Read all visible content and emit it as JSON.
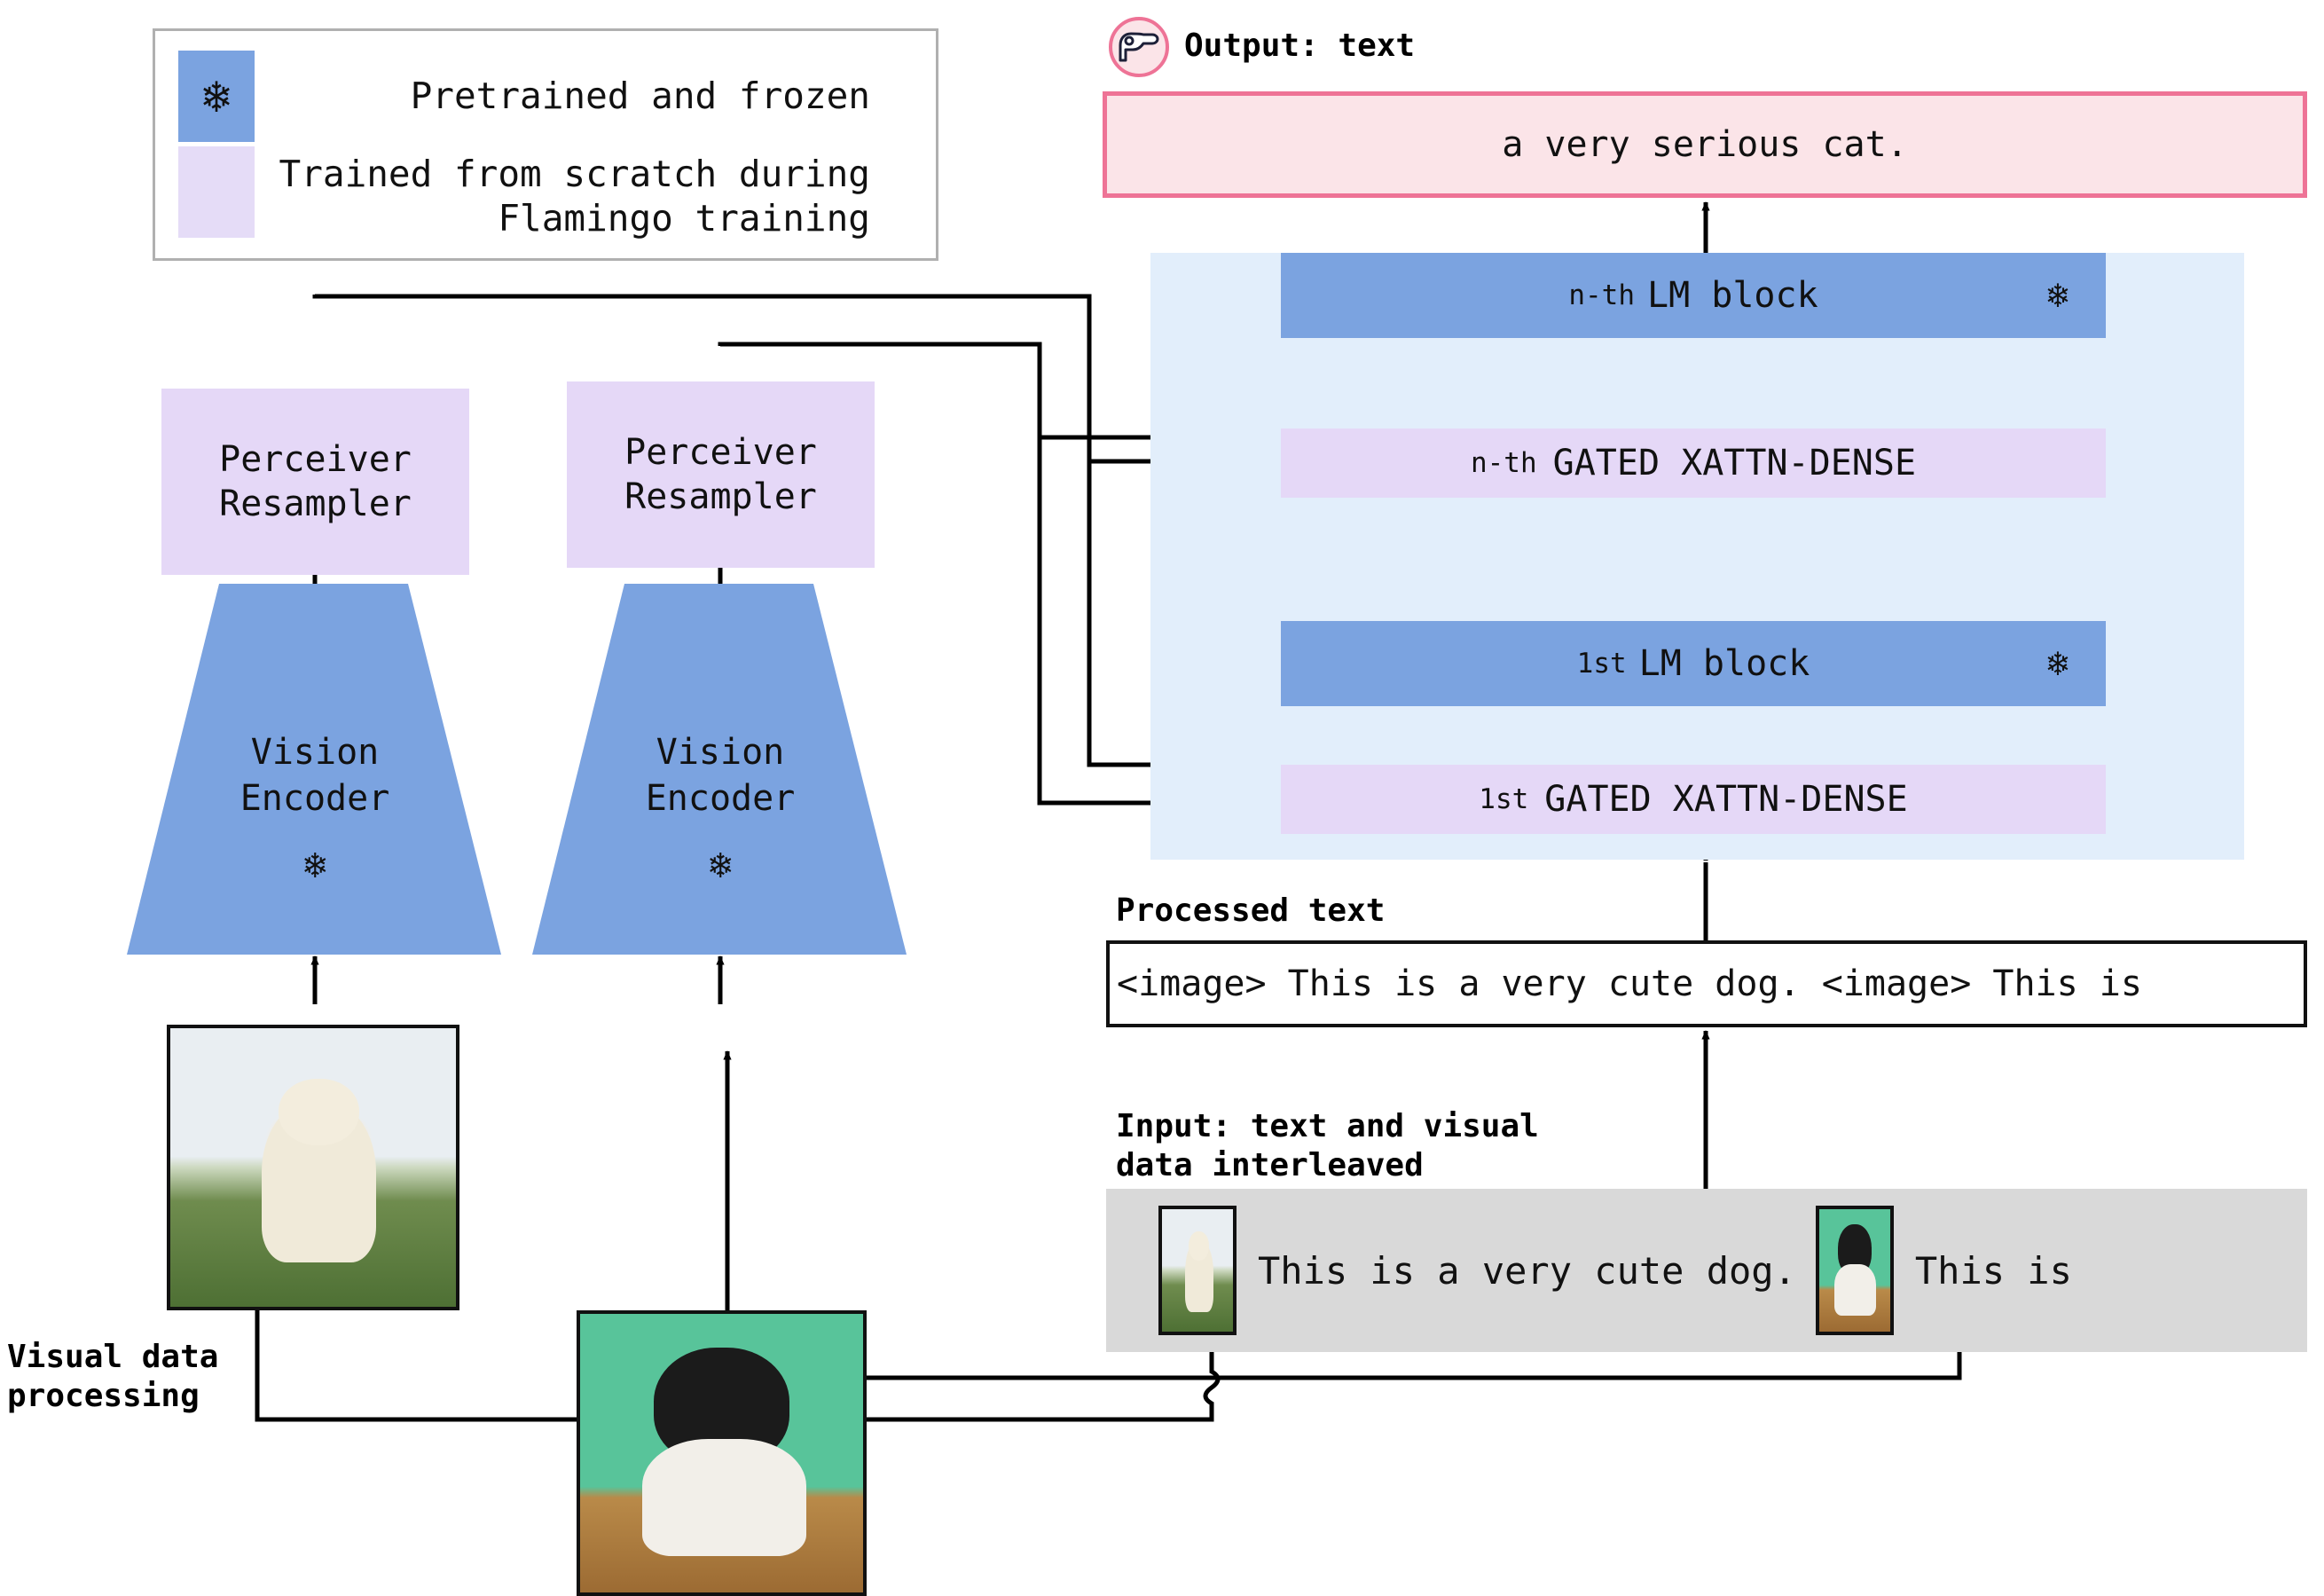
{
  "legend": {
    "items": [
      {
        "icon": "snowflake-icon",
        "glyph": "❄",
        "label": "Pretrained and frozen",
        "color": "#7ba3e0"
      },
      {
        "icon": "",
        "glyph": "",
        "label": "Trained from scratch\nduring Flamingo training",
        "color": "#e5dcf7"
      }
    ]
  },
  "output": {
    "badge_icon": "flamingo-logo-icon",
    "title": "Output: text",
    "text": "a very serious cat."
  },
  "lm_panel": {
    "background": "#e2eefb",
    "blocks": [
      {
        "type": "lm",
        "prefix": "n-th",
        "name": "LM block",
        "frozen_glyph": "❄",
        "color": "#7ba3e0"
      },
      {
        "type": "xattn",
        "prefix": "n-th",
        "name": "GATED XATTN-DENSE",
        "color": "#e5d8f7"
      },
      {
        "type": "lm",
        "prefix": "1st",
        "name": "LM block",
        "frozen_glyph": "❄",
        "color": "#7ba3e0"
      },
      {
        "type": "xattn",
        "prefix": "1st",
        "name": "GATED XATTN-DENSE",
        "color": "#e5d8f7"
      }
    ],
    "ellipsis": "⋮"
  },
  "vision_branches": [
    {
      "resampler": "Perceiver\nResampler",
      "resampler_line1": "Perceiver",
      "resampler_line2": "Resampler",
      "encoder_line1": "Vision",
      "encoder_line2": "Encoder",
      "encoder_frozen_glyph": "❄",
      "image": "dog-photo"
    },
    {
      "resampler": "Perceiver\nResampler",
      "resampler_line1": "Perceiver",
      "resampler_line2": "Resampler",
      "encoder_line1": "Vision",
      "encoder_line2": "Encoder",
      "encoder_frozen_glyph": "❄",
      "image": "cat-photo"
    }
  ],
  "labels": {
    "visual_data_processing": "Visual data\nprocessing",
    "processed_text": "Processed text",
    "input_interleaved": "Input: text and visual\ndata interleaved"
  },
  "processed_text": {
    "value": "<image> This is a very cute dog. <image> This is"
  },
  "input_sequence": {
    "background": "#d9d9d9",
    "items": [
      {
        "kind": "image",
        "name": "dog-thumbnail"
      },
      {
        "kind": "text",
        "value": "This is a very cute dog."
      },
      {
        "kind": "image",
        "name": "cat-thumbnail"
      },
      {
        "kind": "text",
        "value": "This is"
      }
    ]
  },
  "colors": {
    "frozen_blue": "#7ba3e0",
    "trained_purple": "#e5d8f7",
    "panel_blue": "#e2eefb",
    "output_pink_fill": "#fbe4e8",
    "output_pink_border": "#ee7396",
    "input_gray": "#d9d9d9",
    "wire_black": "#000000"
  }
}
